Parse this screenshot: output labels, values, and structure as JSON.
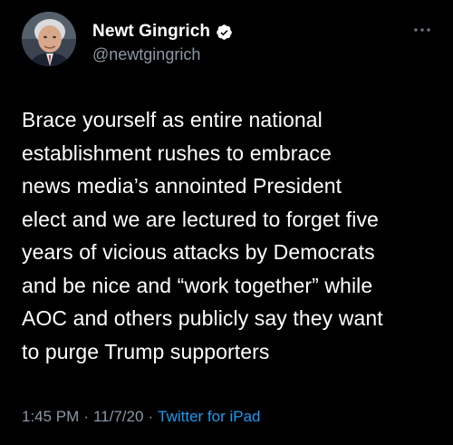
{
  "author": {
    "display_name": "Newt Gingrich",
    "handle": "@newtgingrich",
    "verified": true,
    "avatar_icon": "profile-photo"
  },
  "tweet": {
    "text_lines": [
      "Brace yourself as entire national",
      "establishment rushes to embrace",
      "news media’s annointed President",
      "elect and we are lectured to forget five",
      "years of vicious attacks by Democrats",
      "and be nice and “work together” while",
      "AOC and others publicly say they want",
      "to purge Trump supporters"
    ]
  },
  "meta": {
    "time": "1:45 PM",
    "date": "11/7/20",
    "separator": "·",
    "source": "Twitter for iPad"
  },
  "colors": {
    "background": "#000000",
    "text": "#ffffff",
    "secondary_text": "#8b98a5",
    "link": "#1d9bf0",
    "verified_badge": "#ffffff"
  }
}
